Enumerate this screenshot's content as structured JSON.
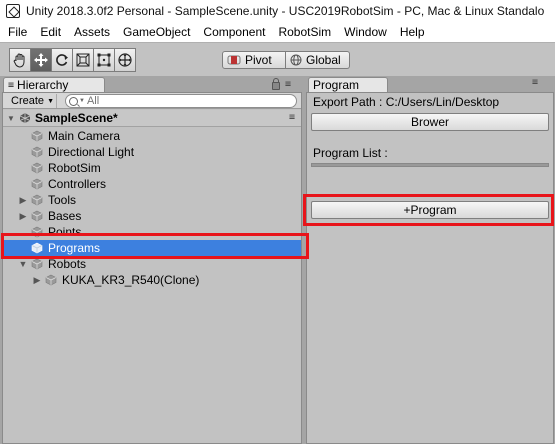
{
  "window": {
    "title": "Unity 2018.3.0f2 Personal - SampleScene.unity - USC2019RobotSim - PC, Mac & Linux Standalo"
  },
  "menu": [
    "File",
    "Edit",
    "Assets",
    "GameObject",
    "Component",
    "RobotSim",
    "Window",
    "Help"
  ],
  "toolbar": {
    "tools": [
      "hand-tool",
      "move-tool",
      "rotate-tool",
      "scale-tool",
      "rect-tool",
      "transform-tool"
    ],
    "active_tool": "move-tool",
    "pivot_label": "Pivot",
    "global_label": "Global"
  },
  "hierarchy": {
    "tab_label": "Hierarchy",
    "create_label": "Create",
    "search_placeholder": "All",
    "scene_name": "SampleScene*",
    "items": [
      {
        "label": "Main Camera",
        "depth": 1,
        "expandable": false
      },
      {
        "label": "Directional Light",
        "depth": 1,
        "expandable": false
      },
      {
        "label": "RobotSim",
        "depth": 1,
        "expandable": false
      },
      {
        "label": "Controllers",
        "depth": 1,
        "expandable": false
      },
      {
        "label": "Tools",
        "depth": 1,
        "expandable": true
      },
      {
        "label": "Bases",
        "depth": 1,
        "expandable": true
      },
      {
        "label": "Points",
        "depth": 1,
        "expandable": false
      },
      {
        "label": "Programs",
        "depth": 1,
        "expandable": false,
        "selected": true
      },
      {
        "label": "Robots",
        "depth": 1,
        "expandable": true,
        "expanded": true
      },
      {
        "label": "KUKA_KR3_R540(Clone)",
        "depth": 2,
        "expandable": true
      }
    ]
  },
  "program": {
    "tab_label": "Program",
    "export_path_label": "Export Path : C:/Users/Lin/Desktop",
    "browse_button": "Brower",
    "program_list_label": "Program List :",
    "add_program_button": "+Program"
  },
  "colors": {
    "highlight": "#e8141a",
    "selection": "#3d80df",
    "panel": "#c2c2c2"
  }
}
